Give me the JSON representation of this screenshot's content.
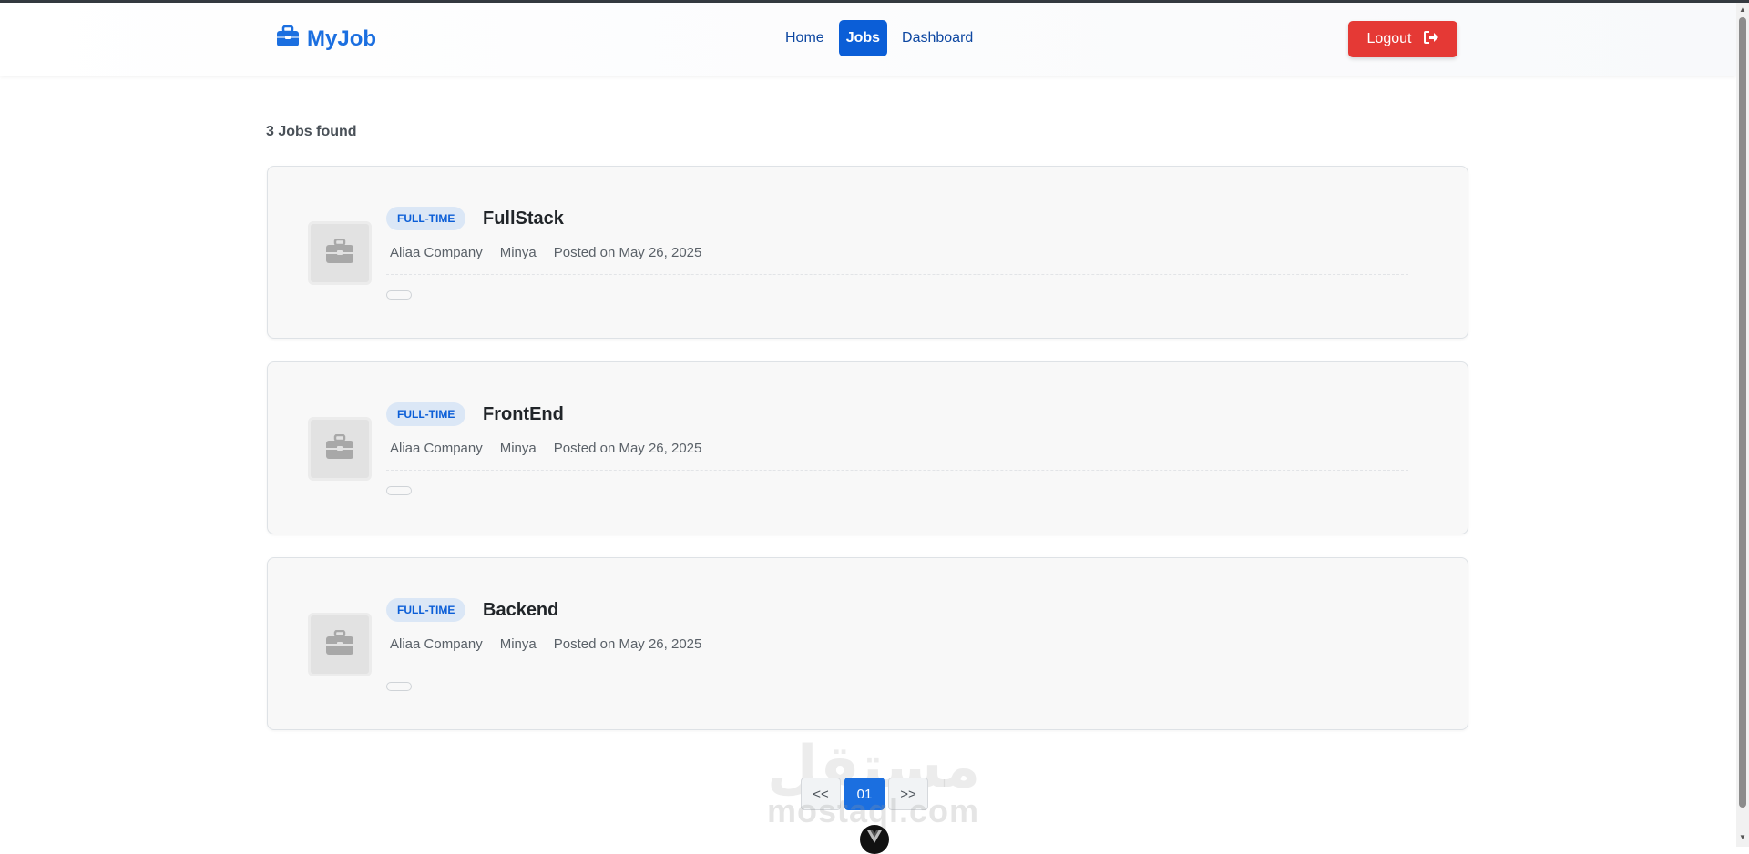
{
  "brand": {
    "name": "MyJob",
    "icon": "briefcase-icon",
    "color": "#1b6fe0"
  },
  "nav": {
    "items": [
      {
        "label": "Home",
        "active": false
      },
      {
        "label": "Jobs",
        "active": true
      },
      {
        "label": "Dashboard",
        "active": false
      }
    ]
  },
  "logout": {
    "label": "Logout",
    "icon": "sign-out-icon",
    "color": "#e53935"
  },
  "results": {
    "count_text": "3 Jobs found"
  },
  "jobs": [
    {
      "type": "FULL-TIME",
      "title": "FullStack",
      "company": "Aliaa Company",
      "location": "Minya",
      "posted": "Posted on May 26, 2025"
    },
    {
      "type": "FULL-TIME",
      "title": "FrontEnd",
      "company": "Aliaa Company",
      "location": "Minya",
      "posted": "Posted on May 26, 2025"
    },
    {
      "type": "FULL-TIME",
      "title": "Backend",
      "company": "Aliaa Company",
      "location": "Minya",
      "posted": "Posted on May 26, 2025"
    }
  ],
  "pagination": {
    "prev_label": "<<",
    "current": "01",
    "next_label": ">>"
  },
  "watermark": {
    "arabic": "مستقل",
    "latin": "mostaql.com"
  }
}
